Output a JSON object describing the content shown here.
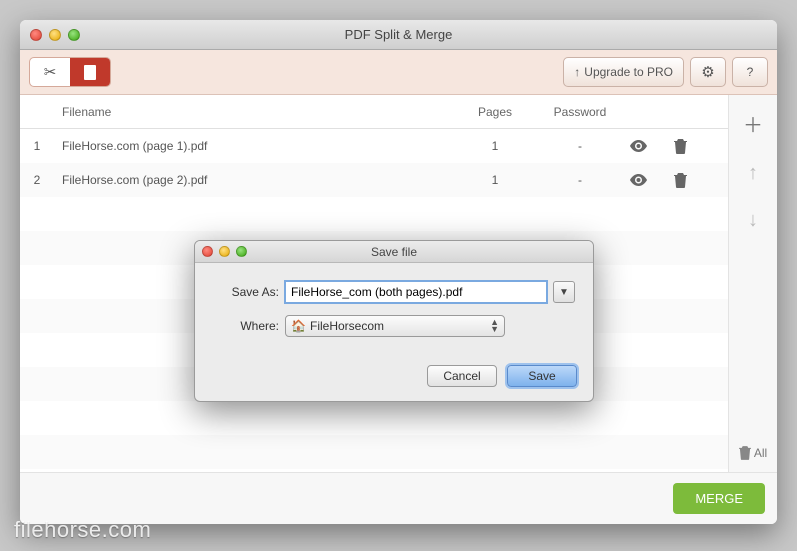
{
  "window": {
    "title": "PDF Split & Merge"
  },
  "toolbar": {
    "upgrade_label": "Upgrade to PRO",
    "gear_label": "⚙",
    "help_label": "?"
  },
  "table": {
    "headers": {
      "filename": "Filename",
      "pages": "Pages",
      "password": "Password"
    },
    "rows": [
      {
        "idx": "1",
        "name": "FileHorse.com (page 1).pdf",
        "pages": "1",
        "password": "-"
      },
      {
        "idx": "2",
        "name": "FileHorse.com (page 2).pdf",
        "pages": "1",
        "password": "-"
      }
    ]
  },
  "sidebar": {
    "delete_all_label": "All"
  },
  "bottom": {
    "merge_label": "MERGE"
  },
  "dialog": {
    "title": "Save file",
    "save_as_label": "Save As:",
    "save_as_value": "FileHorse_com (both pages).pdf",
    "where_label": "Where:",
    "where_value": "FileHorsecom",
    "cancel_label": "Cancel",
    "save_label": "Save"
  },
  "watermark": "filehorse.com"
}
